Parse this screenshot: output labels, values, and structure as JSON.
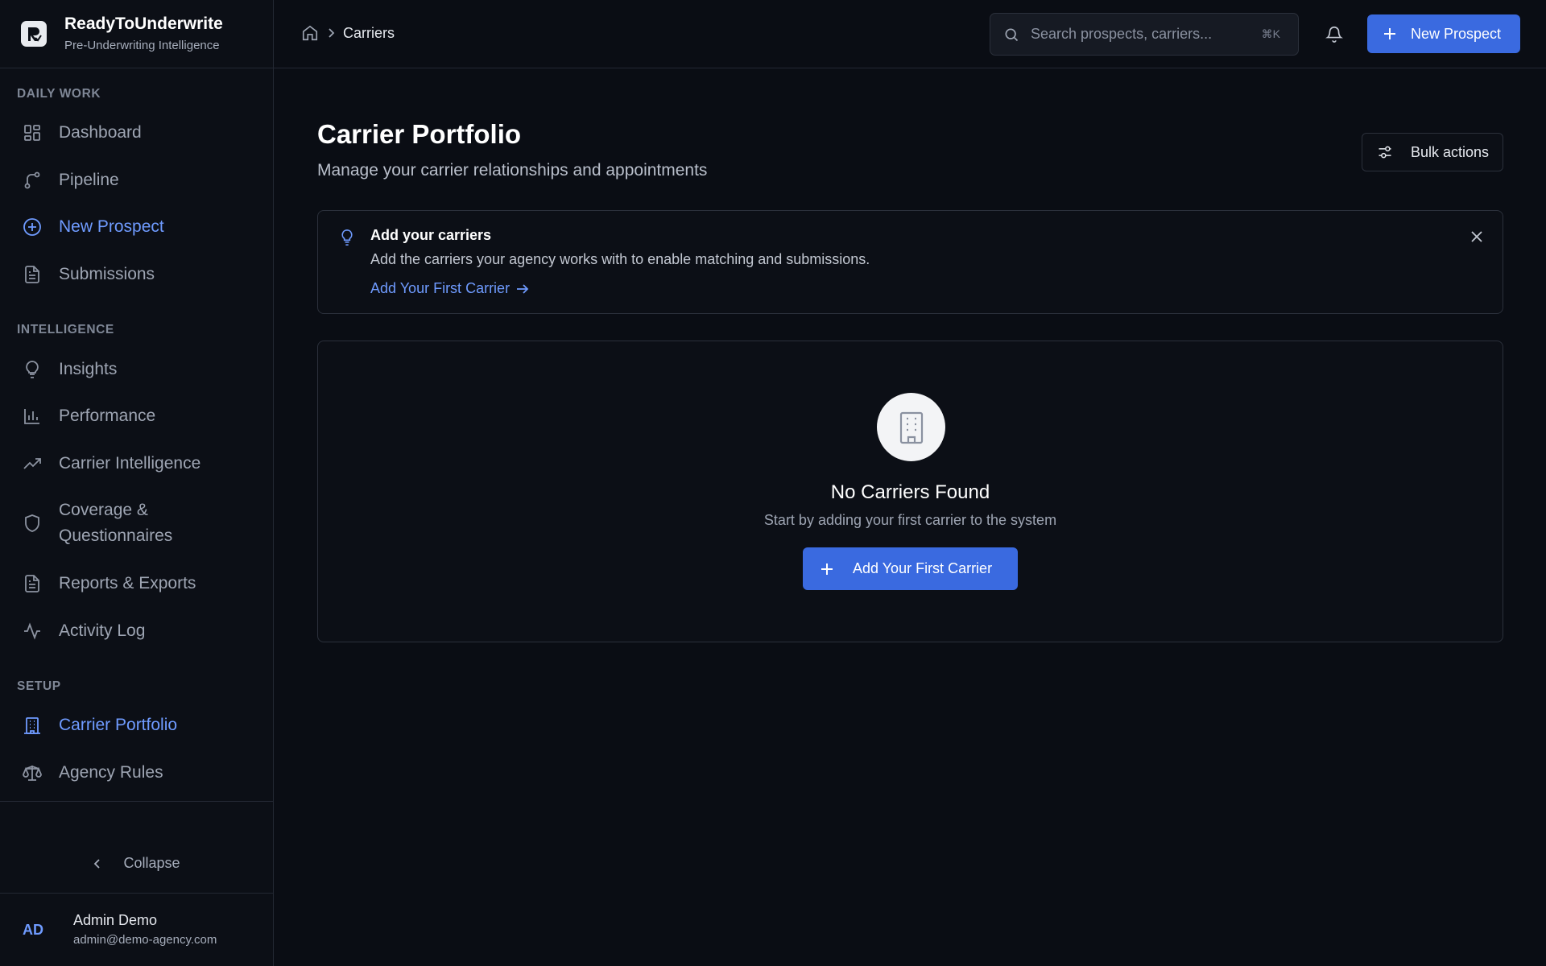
{
  "app": {
    "name": "ReadyToUnderwrite",
    "tagline": "Pre-Underwriting Intelligence"
  },
  "sidebar": {
    "sections": [
      {
        "title": "DAILY WORK",
        "items": [
          {
            "label": "Dashboard",
            "icon": "dashboard-icon",
            "active": false
          },
          {
            "label": "Pipeline",
            "icon": "pipeline-icon",
            "active": false
          },
          {
            "label": "New Prospect",
            "icon": "plus-circle-icon",
            "active": true
          },
          {
            "label": "Submissions",
            "icon": "document-icon",
            "active": false
          }
        ]
      },
      {
        "title": "INTELLIGENCE",
        "items": [
          {
            "label": "Insights",
            "icon": "lightbulb-icon",
            "active": false
          },
          {
            "label": "Performance",
            "icon": "bar-chart-icon",
            "active": false
          },
          {
            "label": "Carrier Intelligence",
            "icon": "trending-up-icon",
            "active": false
          },
          {
            "label": "Coverage & Questionnaires",
            "icon": "shield-icon",
            "active": false
          },
          {
            "label": "Reports & Exports",
            "icon": "document-icon",
            "active": false
          },
          {
            "label": "Activity Log",
            "icon": "activity-icon",
            "active": false
          }
        ]
      },
      {
        "title": "SETUP",
        "items": [
          {
            "label": "Carrier Portfolio",
            "icon": "building-icon",
            "active": true
          },
          {
            "label": "Agency Rules",
            "icon": "scale-icon",
            "active": false
          }
        ]
      }
    ],
    "collapse_label": "Collapse",
    "user": {
      "initials": "AD",
      "name": "Admin Demo",
      "email": "admin@demo-agency.com"
    }
  },
  "topbar": {
    "breadcrumb_current": "Carriers",
    "search_placeholder": "Search prospects, carriers...",
    "search_shortcut": "⌘K",
    "new_prospect_label": "New Prospect"
  },
  "page": {
    "title": "Carrier Portfolio",
    "subtitle": "Manage your carrier relationships and appointments",
    "bulk_actions_label": "Bulk actions"
  },
  "tip": {
    "title": "Add your carriers",
    "text": "Add the carriers your agency works with to enable matching and submissions.",
    "link_label": "Add Your First Carrier"
  },
  "empty_state": {
    "title": "No Carriers Found",
    "subtitle": "Start by adding your first carrier to the system",
    "button_label": "Add Your First Carrier"
  },
  "colors": {
    "accent": "#3a6ae0",
    "active_nav": "#6f9bff",
    "background": "#0a0d14"
  }
}
